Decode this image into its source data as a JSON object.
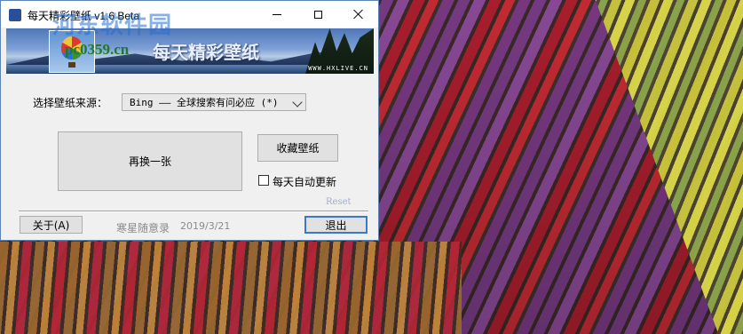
{
  "window": {
    "title": "每天精彩壁纸 v1.6 Beta",
    "banner": {
      "title": "每天精彩壁纸",
      "site": "WWW.HXLIVE.CN",
      "overlay_url": "pc0359.cn",
      "watermark": "河东软件园"
    }
  },
  "source": {
    "label": "选择壁纸来源：",
    "selected": "Bing —— 全球搜索有问必应 (*)"
  },
  "buttons": {
    "next": "再换一张",
    "favorite": "收藏壁纸",
    "about": "关于(A)",
    "exit": "退出"
  },
  "auto_update": {
    "label": "每天自动更新",
    "checked": false
  },
  "reset_label": "Reset",
  "footer": {
    "author": "寒星随意录",
    "date": "2019/3/21"
  },
  "icons": [
    "app-icon",
    "minimize-icon",
    "maximize-icon",
    "close-icon",
    "chevron-down-icon",
    "balloon-icon"
  ],
  "colors": {
    "window_bg": "#f0f0f0",
    "exit_border": "#3a78c8",
    "watermark": "#266ed2",
    "reset_text": "#a0aec8"
  }
}
